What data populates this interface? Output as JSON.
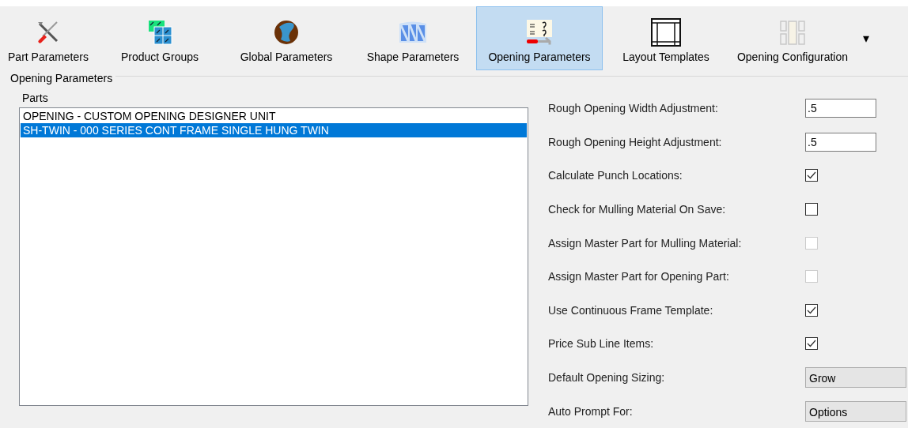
{
  "toolbar": {
    "buttons": [
      {
        "label": "Part Parameters",
        "selected": false
      },
      {
        "label": "Product Groups",
        "selected": false
      },
      {
        "label": "Global Parameters",
        "selected": false
      },
      {
        "label": "Shape Parameters",
        "selected": false
      },
      {
        "label": "Opening Parameters",
        "selected": true
      },
      {
        "label": "Layout Templates",
        "selected": false
      },
      {
        "label": "Opening Configuration",
        "selected": false
      }
    ],
    "overflow": "▾"
  },
  "group": {
    "title": "Opening Parameters"
  },
  "parts": {
    "label": "Parts",
    "items": [
      {
        "text": "OPENING - CUSTOM OPENING DESIGNER UNIT",
        "selected": false
      },
      {
        "text": "SH-TWIN - 000 SERIES CONT FRAME SINGLE HUNG TWIN",
        "selected": true
      }
    ]
  },
  "settings": [
    {
      "kind": "text",
      "label": "Rough Opening Width Adjustment:",
      "value": ".5"
    },
    {
      "kind": "text",
      "label": "Rough Opening Height Adjustment:",
      "value": ".5"
    },
    {
      "kind": "checkbox",
      "label": "Calculate Punch Locations:",
      "checked": true,
      "disabled": false
    },
    {
      "kind": "checkbox",
      "label": "Check for Mulling Material On Save:",
      "checked": false,
      "disabled": false
    },
    {
      "kind": "checkbox",
      "label": "Assign Master Part for Mulling Material:",
      "checked": false,
      "disabled": true
    },
    {
      "kind": "checkbox",
      "label": "Assign Master Part for Opening Part:",
      "checked": false,
      "disabled": true
    },
    {
      "kind": "checkbox",
      "label": "Use Continuous Frame Template:",
      "checked": true,
      "disabled": false
    },
    {
      "kind": "checkbox",
      "label": "Price Sub Line Items:",
      "checked": true,
      "disabled": false
    },
    {
      "kind": "dropdown",
      "label": "Default Opening Sizing:",
      "value": "Grow"
    },
    {
      "kind": "dropdown",
      "label": "Auto Prompt For:",
      "value": "Options"
    }
  ]
}
